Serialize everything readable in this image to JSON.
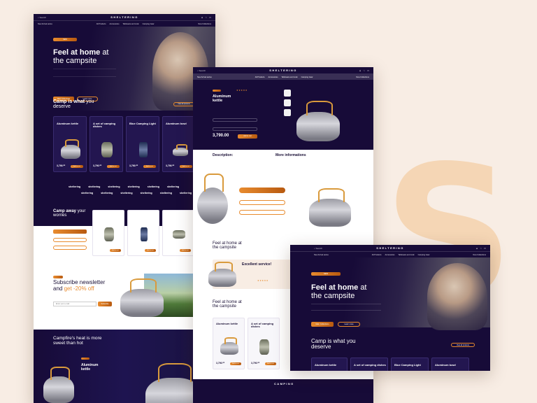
{
  "brand": "SHELTERING",
  "brand_alt": "CAMPING",
  "background_letter": "S",
  "nav": {
    "search": "Search",
    "tagline": "New Arrival series",
    "items": [
      "All Products",
      "Accessories",
      "Tableware and cook",
      "Camping Gear"
    ],
    "right": "New Collections"
  },
  "hero": {
    "title_bold": "Feel at home",
    "title_rest": "at",
    "title_line2": "the campsite",
    "btn_primary": "Main Collections",
    "btn_secondary": "Learn more"
  },
  "section_camp": {
    "title_bold": "Camp is what",
    "title_rest": "you",
    "title_line2": "deserve",
    "btn": "View all products"
  },
  "products": [
    {
      "name": "Aluminum kettle",
      "price": "3,790.⁰⁰",
      "btn": "Add to cart",
      "tag": "NEW"
    },
    {
      "name": "A set of camping dishes",
      "price": "3,790.⁰⁰",
      "btn": "Add to cart",
      "tag": "NEW"
    },
    {
      "name": "Blue Camping Light",
      "price": "3,790.⁰⁰",
      "btn": "Add to cart",
      "tag": "NEW"
    },
    {
      "name": "Aluminum bowl",
      "price": "3,790.⁰⁰",
      "btn": "Add to cart",
      "tag": "NEW"
    }
  ],
  "marquee_word": "sheltering",
  "section_away": {
    "title_bold": "Camp away",
    "title_rest": "your",
    "title_line2": "worries"
  },
  "newsletter": {
    "title": "Subscribe newsletter",
    "title2_a": "and",
    "title2_b": "get -20% off",
    "placeholder": "Enter your e-mail",
    "btn": "Subscribe"
  },
  "campfire": {
    "title_bold": "Campfire's heat",
    "title_rest": "is more",
    "title_line2": "sweet than hot"
  },
  "product_page": {
    "name": "Aluminum kettle",
    "price": "3,790.00",
    "btn": "Add to cart",
    "description": "Description:",
    "more_info": "More informations",
    "excellent": "Excellent service!"
  }
}
